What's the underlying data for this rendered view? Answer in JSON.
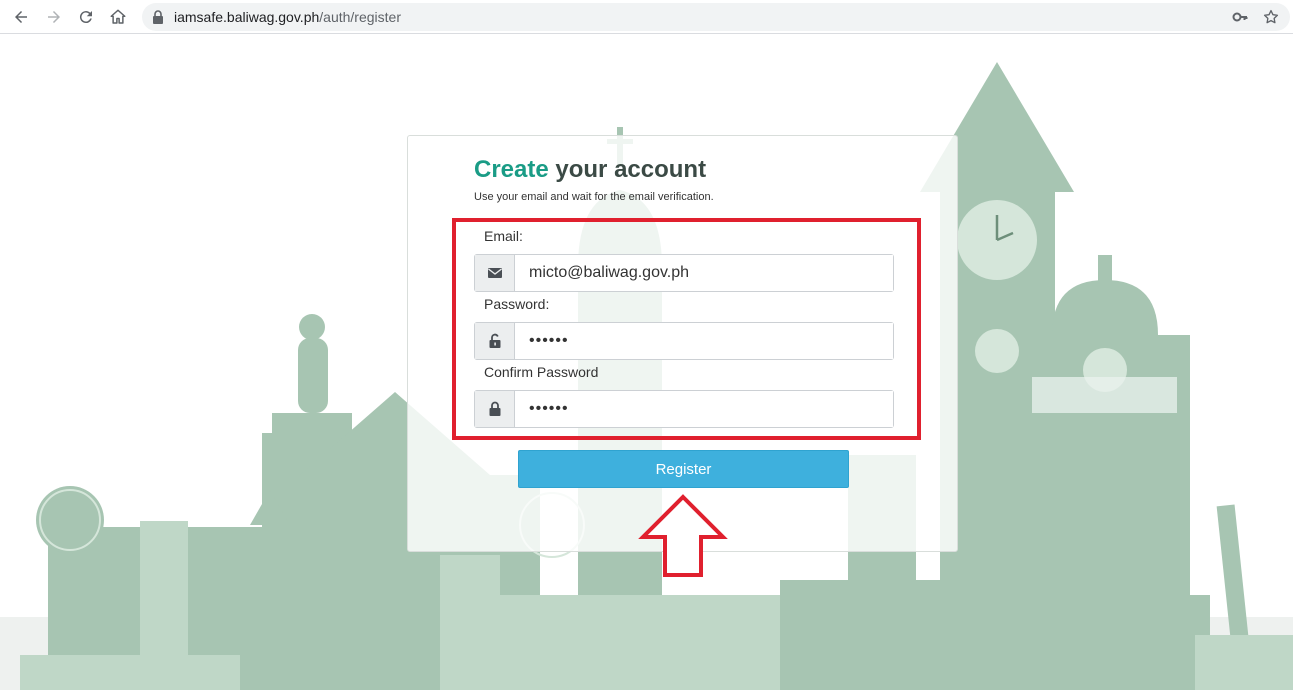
{
  "browser": {
    "url_domain": "iamsafe.baliwag.gov.ph",
    "url_path": "/auth/register"
  },
  "form": {
    "title_accent": "Create",
    "title_rest": " your account",
    "subtitle": "Use your email and wait for the email verification.",
    "email_label": "Email:",
    "email_value": "micto@baliwag.gov.ph",
    "password_label": "Password:",
    "password_value": "••••••",
    "confirm_label": "Confirm Password",
    "confirm_value": "••••••",
    "register_label": "Register"
  },
  "colors": {
    "accent": "#1a9c86",
    "button": "#3eb0dd",
    "highlight": "#e0202e",
    "illustration": "#9fbfa9"
  }
}
